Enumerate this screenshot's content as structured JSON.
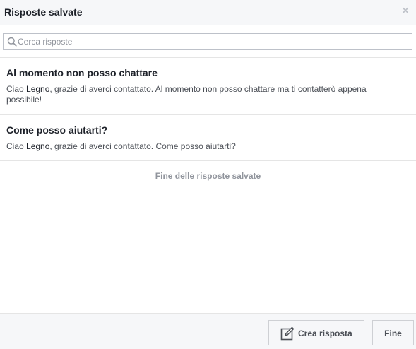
{
  "dialog": {
    "title": "Risposte salvate",
    "close_symbol": "×"
  },
  "search": {
    "placeholder": "Cerca risposte",
    "value": ""
  },
  "replies": [
    {
      "title": "Al momento non posso chattare",
      "text_prefix": "Ciao ",
      "name": "Legno",
      "text_suffix": ", grazie di averci contattato. Al momento non posso chattare ma ti contatterò appena possibile!"
    },
    {
      "title": "Come posso aiutarti?",
      "text_prefix": "Ciao ",
      "name": "Legno",
      "text_suffix": ", grazie di averci contattato. Come posso aiutarti?"
    }
  ],
  "end_note": "Fine delle risposte salvate",
  "footer": {
    "create_label": "Crea risposta",
    "done_label": "Fine"
  },
  "icons": {
    "search": "search-icon",
    "close": "close-icon",
    "edit": "edit-icon"
  },
  "colors": {
    "header_bg": "#f6f7f9",
    "border": "#e5e5e5",
    "text": "#1d2129",
    "muted": "#90949c"
  }
}
